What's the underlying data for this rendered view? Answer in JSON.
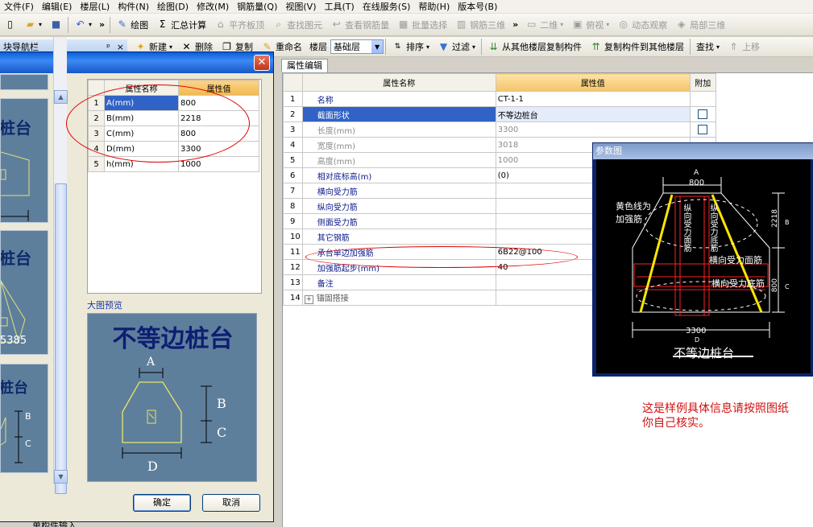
{
  "menu": [
    "文件(F)",
    "编辑(E)",
    "楼层(L)",
    "构件(N)",
    "绘图(D)",
    "修改(M)",
    "钢筋量(Q)",
    "视图(V)",
    "工具(T)",
    "在线服务(S)",
    "帮助(H)",
    "版本号(B)"
  ],
  "toolbar1": {
    "draw": "绘图",
    "summary": "汇总计算",
    "flat_slab": "平齐板顶",
    "find_elem": "查找图元",
    "view_rebar": "查看钢筋量",
    "batch_select": "批量选择",
    "rebar_3d": "钢筋三维",
    "view_2d": "二维",
    "top_view": "俯视",
    "dynamic": "动态观察",
    "local_3d": "局部三维",
    "chevron": "»"
  },
  "toolbar2": {
    "nav_title": "块导航栏",
    "pin": "ᵖ",
    "close": "×",
    "new": "新建",
    "delete": "删除",
    "copy": "复制",
    "rename": "重命名",
    "floor_label": "楼层",
    "floor_value": "基础层",
    "sort": "排序",
    "filter": "过滤",
    "copy_from": "从其他楼层复制构件",
    "copy_to": "复制构件到其他楼层",
    "find": "查找",
    "move_up": "上移"
  },
  "dialog": {
    "close": "✕",
    "thumb_labels": [
      "桩台",
      "桩台",
      "桩台"
    ],
    "thumb_number": "5385",
    "thumb_digit": "1",
    "thumb_b": "B",
    "thumb_c": "C",
    "param_headers": {
      "name": "属性名称",
      "value": "属性值"
    },
    "params": [
      {
        "idx": "1",
        "name": "A(mm)",
        "value": "800"
      },
      {
        "idx": "2",
        "name": "B(mm)",
        "value": "2218"
      },
      {
        "idx": "3",
        "name": "C(mm)",
        "value": "800"
      },
      {
        "idx": "4",
        "name": "D(mm)",
        "value": "3300"
      },
      {
        "idx": "5",
        "name": "h(mm)",
        "value": "1000"
      }
    ],
    "preview_label": "大图预览",
    "preview_title": "不等边桩台",
    "preview_A": "A",
    "preview_B": "B",
    "preview_C": "C",
    "preview_D": "D",
    "ok": "确定",
    "cancel": "取消"
  },
  "main": {
    "tab": "属性编辑",
    "headers": {
      "name": "属性名称",
      "value": "属性值",
      "extra": "附加"
    },
    "rows": [
      {
        "idx": "1",
        "name": "名称",
        "value": "CT-1-1",
        "cb": false
      },
      {
        "idx": "2",
        "name": "截面形状",
        "value": "不等边桩台",
        "cb": true
      },
      {
        "idx": "3",
        "name": "长度(mm)",
        "value": "3300",
        "cb": true
      },
      {
        "idx": "4",
        "name": "宽度(mm)",
        "value": "3018",
        "cb": false
      },
      {
        "idx": "5",
        "name": "高度(mm)",
        "value": "1000",
        "cb": false
      },
      {
        "idx": "6",
        "name": "相对底标高(m)",
        "value": "(0)",
        "cb": false
      },
      {
        "idx": "7",
        "name": "横向受力筋",
        "value": "",
        "cb": false
      },
      {
        "idx": "8",
        "name": "纵向受力筋",
        "value": "",
        "cb": false
      },
      {
        "idx": "9",
        "name": "侧面受力筋",
        "value": "",
        "cb": false
      },
      {
        "idx": "10",
        "name": "其它钢筋",
        "value": "",
        "cb": false
      },
      {
        "idx": "11",
        "name": "承台单边加强筋",
        "value": "6B22@100",
        "cb": false
      },
      {
        "idx": "12",
        "name": "加强筋起步(mm)",
        "value": "40",
        "cb": false
      },
      {
        "idx": "13",
        "name": "备注",
        "value": "",
        "cb": false
      },
      {
        "idx": "14",
        "name": "锚固搭接",
        "value": "",
        "cb": false
      }
    ],
    "expand": "+",
    "note_line1": "这是样例具体信息请按照图纸",
    "note_line2": "你自己核实。"
  },
  "diagram": {
    "title": "参数图",
    "A": "A",
    "A_val": "800",
    "yellow_line": "黄色线为",
    "reinforce": "加强筋",
    "longitudinal": "纵向受力面筋",
    "longitudinal2": "纵向受力底筋",
    "trans_top": "横向受力面筋",
    "trans_bottom": "横向受力底筋",
    "B_val": "2218",
    "B": "B",
    "C_val": "800",
    "C": "C",
    "D_val": "3300",
    "D": "D",
    "caption": "不等边桩台"
  },
  "bottom_text": "单构件输入"
}
